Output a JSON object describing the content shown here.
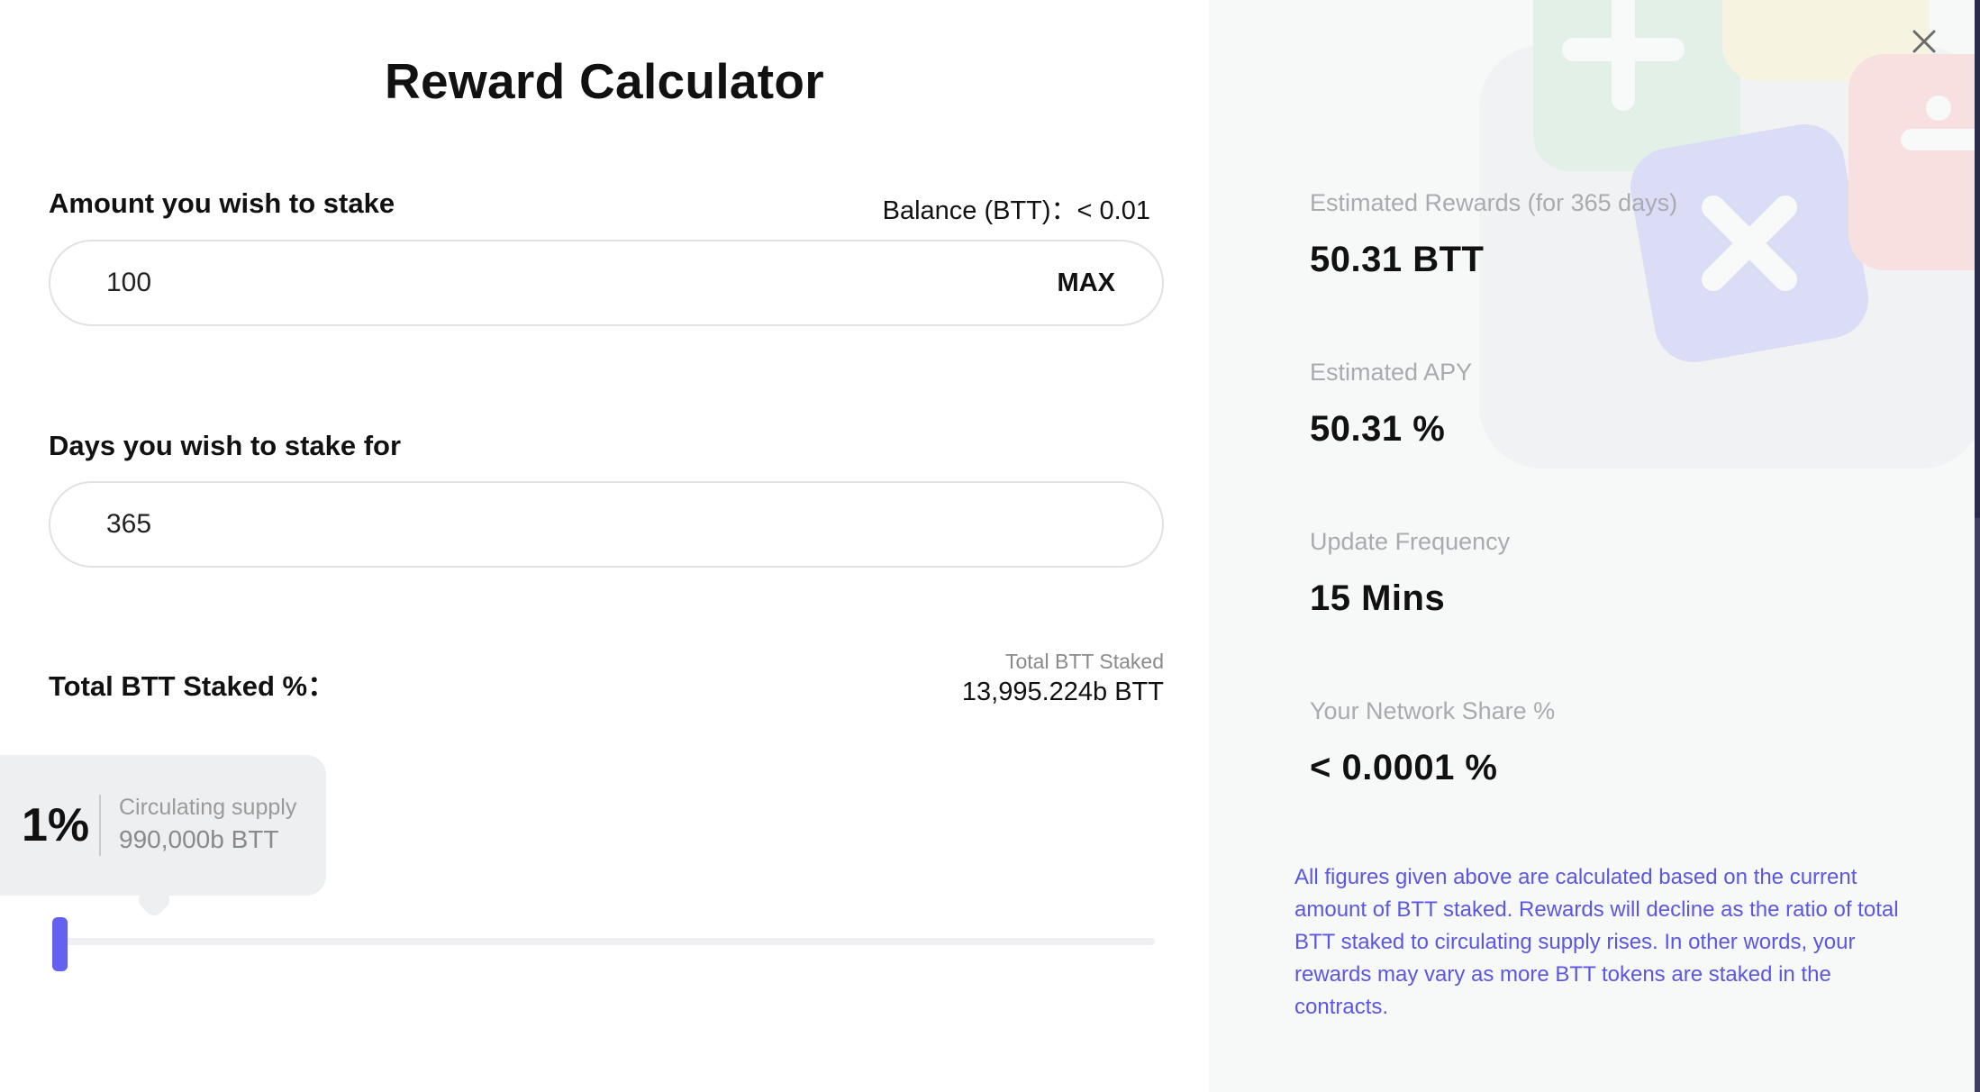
{
  "title": "Reward Calculator",
  "stake_amount": {
    "label": "Amount you wish to stake",
    "balance_text": "Balance (BTT)：< 0.01",
    "value": "100",
    "max_label": "MAX"
  },
  "stake_days": {
    "label": "Days you wish to stake for",
    "value": "365"
  },
  "staked_percent": {
    "label": "Total BTT Staked %：",
    "total_caption": "Total BTT Staked",
    "total_value": "13,995.224b BTT",
    "tooltip_percent": "1%",
    "supply_caption": "Circulating supply",
    "supply_value": "990,000b BTT",
    "slider_level_percent": 1
  },
  "results": {
    "rewards_caption": "Estimated Rewards (for 365 days)",
    "rewards_value": "50.31 BTT",
    "apy_caption": "Estimated APY",
    "apy_value": "50.31 %",
    "frequency_caption": "Update Frequency",
    "frequency_value": "15 Mins",
    "share_caption": "Your Network Share %",
    "share_value": "< 0.0001 %",
    "disclaimer": "All figures given above are calculated based on the current amount of BTT staked. Rewards will decline as the ratio of total BTT staked to circulating supply rises. In other words, your rewards may vary as more BTT tokens are staked in the contracts."
  },
  "colors": {
    "accent": "#6460f0",
    "disclaimer_text": "#5b57e2",
    "right_panel_bg": "#f7f8f8"
  },
  "icons": {
    "close": "close-icon"
  }
}
